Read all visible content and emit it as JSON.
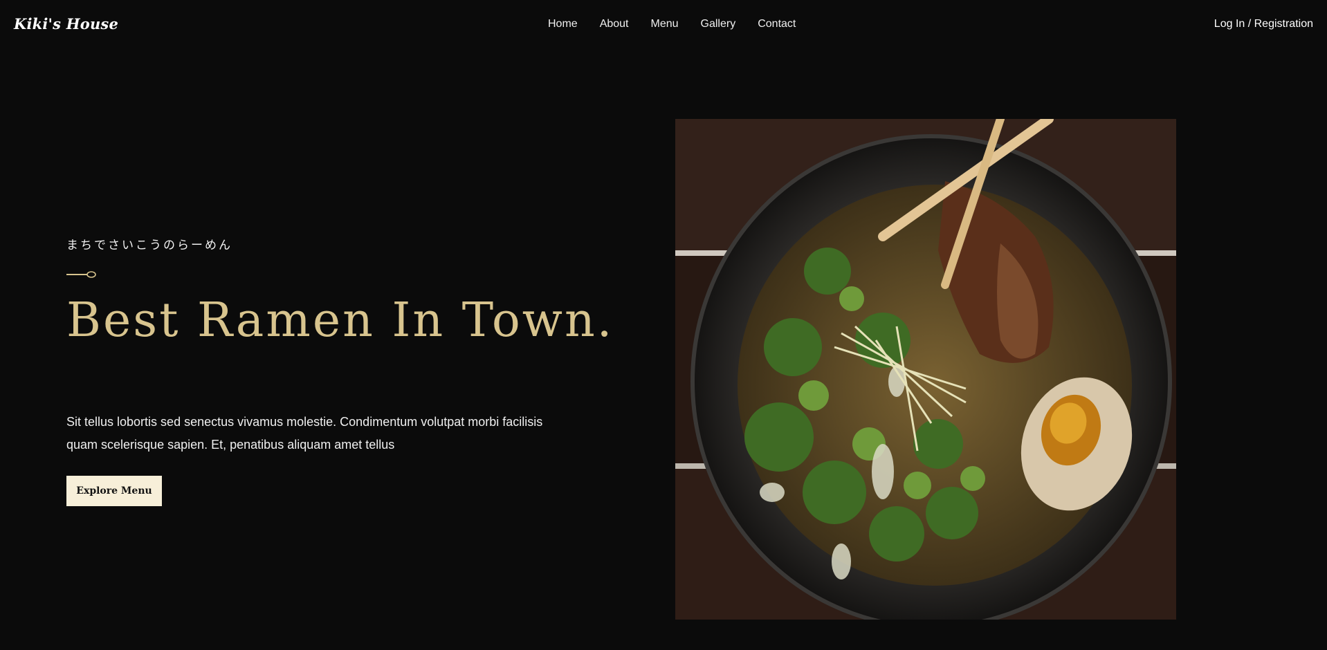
{
  "nav": {
    "logo": "Kiki's House",
    "links": [
      "Home",
      "About",
      "Menu",
      "Gallery",
      "Contact"
    ],
    "login": "Log In / Registration"
  },
  "hero": {
    "tagline": "まちでさいこうのらーめん",
    "headline": "Best Ramen In Town.",
    "description": "Sit tellus lobortis sed senectus vivamus molestie. Condimentum volutpat morbi facilisis quam scelerisque sapien. Et, penatibus aliquam amet tellus",
    "cta": "Explore Menu",
    "image_subject": "bowl of ramen with chopsticks and soft-boiled egg"
  },
  "colors": {
    "background": "#0b0b0b",
    "accent_gold": "#d8c48e",
    "button_bg": "#f7efd9"
  }
}
